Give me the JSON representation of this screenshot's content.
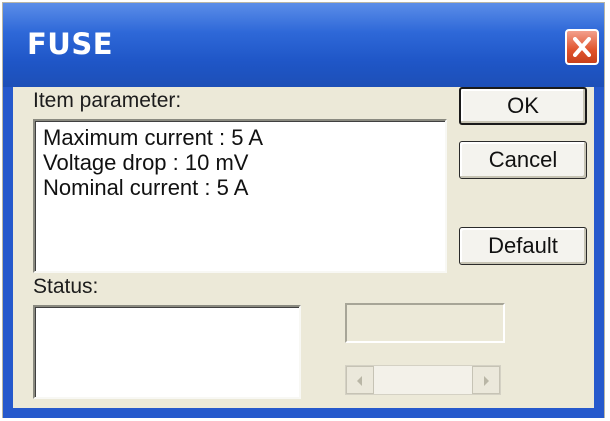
{
  "window": {
    "title": "FUSE"
  },
  "item_parameter": {
    "label": "Item parameter:",
    "lines": [
      "Maximum current : 5  A",
      "Voltage drop : 10  mV",
      "Nominal current : 5  A"
    ]
  },
  "status": {
    "label": "Status:",
    "value": ""
  },
  "buttons": {
    "ok": "OK",
    "cancel": "Cancel",
    "default": "Default"
  },
  "icons": {
    "close": "close-icon",
    "scroll_left": "arrow-left-icon",
    "scroll_right": "arrow-right-icon"
  },
  "colors": {
    "title_bar": "#2659cc",
    "close_button": "#e0532c",
    "dialog_background": "#ece9d8"
  }
}
